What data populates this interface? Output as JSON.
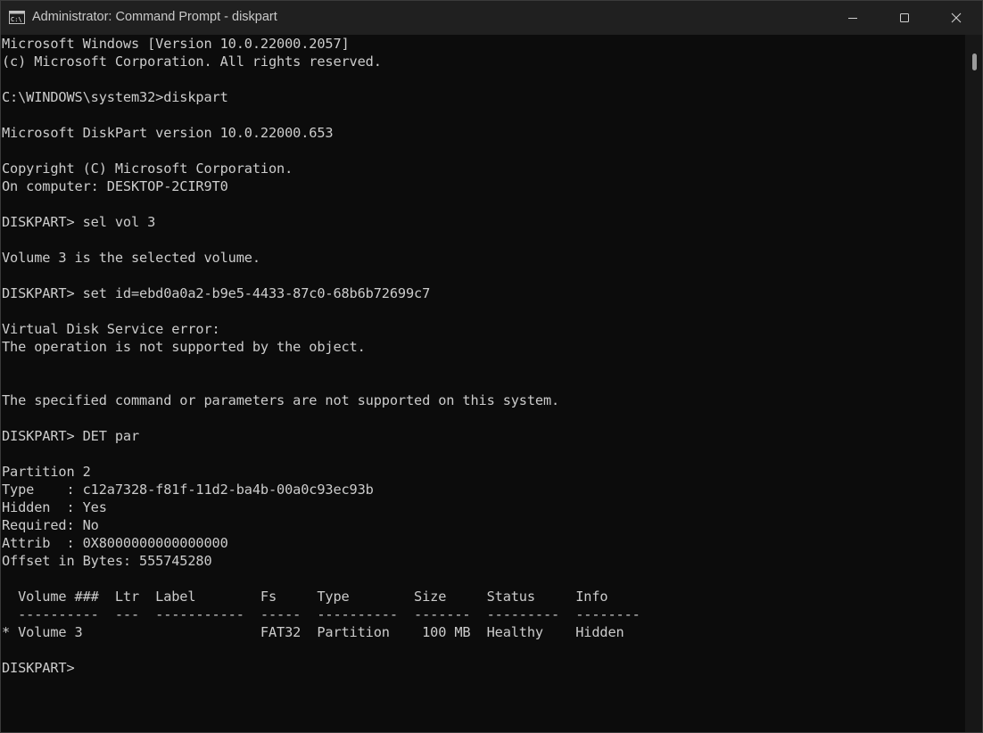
{
  "window": {
    "title": "Administrator: Command Prompt - diskpart",
    "icon": "command-prompt-icon",
    "controls": [
      "minimize-icon",
      "maximize-icon",
      "close-icon"
    ]
  },
  "console": {
    "lines": [
      "Microsoft Windows [Version 10.0.22000.2057]",
      "(c) Microsoft Corporation. All rights reserved.",
      "",
      "C:\\WINDOWS\\system32>diskpart",
      "",
      "Microsoft DiskPart version 10.0.22000.653",
      "",
      "Copyright (C) Microsoft Corporation.",
      "On computer: DESKTOP-2CIR9T0",
      "",
      "DISKPART> sel vol 3",
      "",
      "Volume 3 is the selected volume.",
      "",
      "DISKPART> set id=ebd0a0a2-b9e5-4433-87c0-68b6b72699c7",
      "",
      "Virtual Disk Service error:",
      "The operation is not supported by the object.",
      "",
      "",
      "The specified command or parameters are not supported on this system.",
      "",
      "DISKPART> DET par",
      "",
      "Partition 2",
      "Type    : c12a7328-f81f-11d2-ba4b-00a0c93ec93b",
      "Hidden  : Yes",
      "Required: No",
      "Attrib  : 0X8000000000000000",
      "Offset in Bytes: 555745280",
      "",
      "  Volume ###  Ltr  Label        Fs     Type        Size     Status     Info",
      "  ----------  ---  -----------  -----  ----------  -------  ---------  --------",
      "* Volume 3                      FAT32  Partition    100 MB  Healthy    Hidden",
      "",
      "DISKPART> "
    ]
  },
  "colors": {
    "titlebar_bg": "#202020",
    "console_bg": "#0c0c0c",
    "console_text": "#cccccc",
    "title_text": "#c9c9c9"
  }
}
